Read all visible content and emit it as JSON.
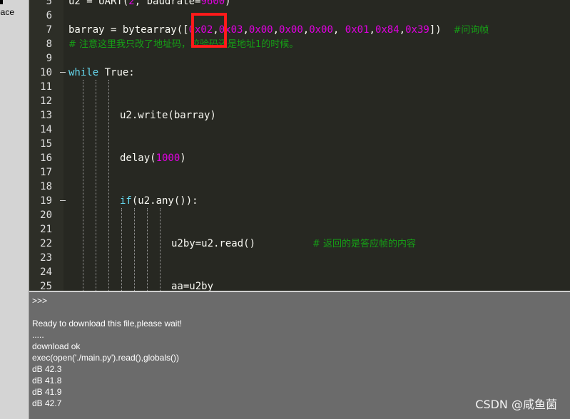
{
  "sidebar": {
    "label": "pace"
  },
  "editor": {
    "line_numbers": [
      "5",
      "6",
      "7",
      "8",
      "9",
      "10",
      "11",
      "12",
      "13",
      "14",
      "15",
      "16",
      "17",
      "18",
      "19",
      "20",
      "21",
      "22",
      "23",
      "24",
      "25"
    ],
    "line5": {
      "a": "u2 = UART(",
      "n1": "2",
      "b": ", baudrate=",
      "n2": "9600",
      "c": ")"
    },
    "line7": {
      "prefix": "barray = bytearray([",
      "b1": "0x02",
      "sep1": ",",
      "b2": "0x03",
      "sep2": ",",
      "b3": "0x00",
      "sep3": ",",
      "b4": "0x00",
      "sep4": ",",
      "b5": "0x00",
      "sep5": ", ",
      "b6": "0x01",
      "sep6": ",",
      "b7": "0x84",
      "sep7": ",",
      "b8": "0x39",
      "suffix": "])  ",
      "comment": "#问询帧"
    },
    "line8": {
      "comment": "# 注意这里我只改了地址码，校验码还是地址1的时候。"
    },
    "line10": {
      "kw": "while",
      "rest": " True:"
    },
    "line13": {
      "text": "u2.write(barray)"
    },
    "line16": {
      "a": "delay(",
      "n": "1000",
      "b": ")"
    },
    "line19": {
      "kw": "if",
      "rest": "(u2.any()):"
    },
    "line22": {
      "code": "u2by=u2.read()",
      "comment": "# 返回的是答应帧的内容"
    },
    "line25": {
      "text": "aa=u2by"
    }
  },
  "console": {
    "lines": [
      ">>>",
      "",
      "Ready to download this file,please wait!",
      ".....",
      "download ok",
      "exec(open('./main.py').read(),globals())",
      "dB 42.3",
      "dB 41.8",
      "dB 41.9",
      "dB 42.7"
    ]
  },
  "watermark": "CSDN @咸鱼菌"
}
